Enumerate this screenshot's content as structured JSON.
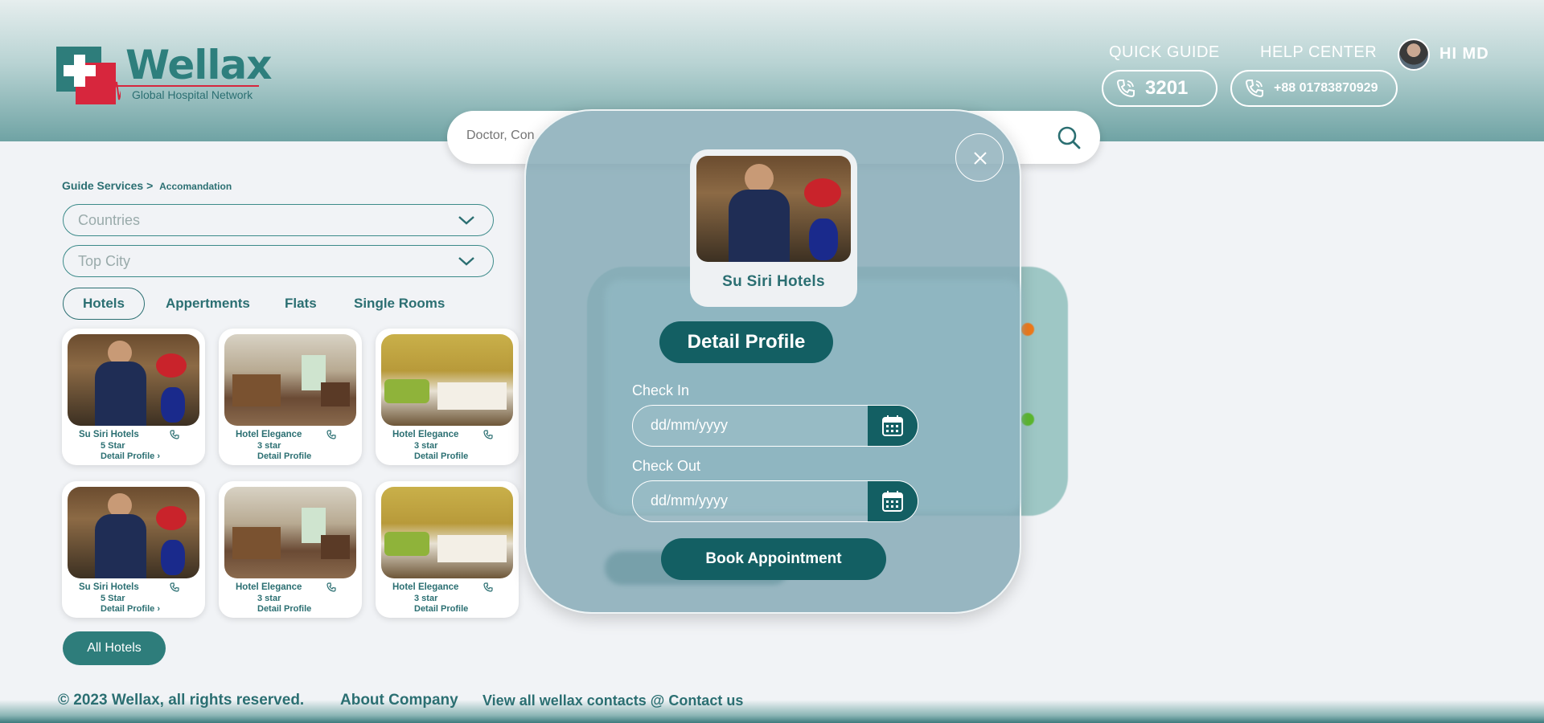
{
  "header": {
    "logo": {
      "name": "Wellax",
      "tagline": "Global Hospital Network"
    },
    "quick_guide": "QUICK GUIDE",
    "help_center": "HELP CENTER",
    "quick_phone": "3201",
    "help_phone": "+88 01783870929",
    "greeting": "HI MD"
  },
  "search": {
    "placeholder": "Doctor, Con"
  },
  "breadcrumb": {
    "parent": "Guide Services",
    "separator": ">",
    "current": "Accomandation"
  },
  "filters": {
    "country_placeholder": "Countries",
    "city_placeholder": "Top City"
  },
  "tabs": [
    {
      "label": "Hotels",
      "active": true
    },
    {
      "label": "Appertments",
      "active": false
    },
    {
      "label": "Flats",
      "active": false
    },
    {
      "label": "Single Rooms",
      "active": false
    }
  ],
  "hotels": [
    {
      "name": "Su Siri Hotels",
      "rating": "5 Star",
      "link": "Detail Profile",
      "has_chevron": true
    },
    {
      "name": "Hotel Elegance",
      "rating": "3 star",
      "link": "Detail Profile",
      "has_chevron": false
    },
    {
      "name": "Hotel Elegance",
      "rating": "3 star",
      "link": "Detail Profile",
      "has_chevron": false
    },
    {
      "name": "Su Siri Hotels",
      "rating": "5 Star",
      "link": "Detail Profile",
      "has_chevron": true
    },
    {
      "name": "Hotel Elegance",
      "rating": "3 star",
      "link": "Detail Profile",
      "has_chevron": false
    },
    {
      "name": "Hotel Elegance",
      "rating": "3 star",
      "link": "Detail Profile",
      "has_chevron": false
    }
  ],
  "all_hotels_label": "All Hotels",
  "modal": {
    "hotel_name": "Su Siri Hotels",
    "detail_button": "Detail Profile",
    "check_in_label": "Check In",
    "check_out_label": "Check Out",
    "date_placeholder": "dd/mm/yyyy",
    "book_button": "Book Appointment"
  },
  "footer": {
    "copyright": "© 2023 Wellax, all rights reserved.",
    "about": "About Company",
    "contacts": "View all wellax contacts @ Contact us"
  },
  "colors": {
    "primary": "#135f63",
    "accent": "#2e7d7b",
    "logo_red": "#d7263d",
    "background": "#f1f3f6"
  }
}
